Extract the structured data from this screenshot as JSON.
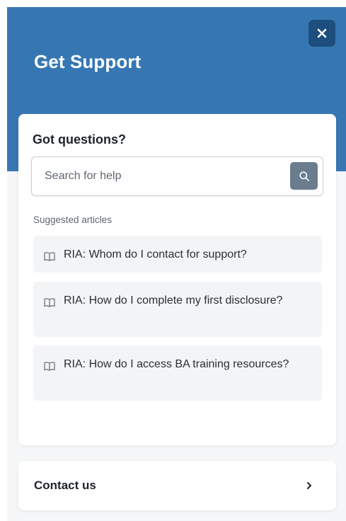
{
  "header": {
    "title": "Get Support",
    "close_icon": "close-icon"
  },
  "help_card": {
    "title": "Got questions?",
    "search": {
      "placeholder": "Search for help",
      "value": "",
      "button_icon": "search-icon"
    },
    "suggested_label": "Suggested articles",
    "articles": [
      {
        "icon": "book-icon",
        "title": "RIA: Whom do I contact for support?"
      },
      {
        "icon": "book-icon",
        "title": "RIA: How do I complete my first disclosure?"
      },
      {
        "icon": "book-icon",
        "title": "RIA: How do I access BA training resources?"
      }
    ]
  },
  "contact": {
    "label": "Contact us",
    "icon": "chevron-right-icon"
  },
  "colors": {
    "header_bg": "#3677b3",
    "close_button_bg": "#1d4e7d",
    "search_button_bg": "#6a7d8e",
    "panel_bg": "#f5f7f9",
    "article_bg": "#f3f4f6"
  }
}
